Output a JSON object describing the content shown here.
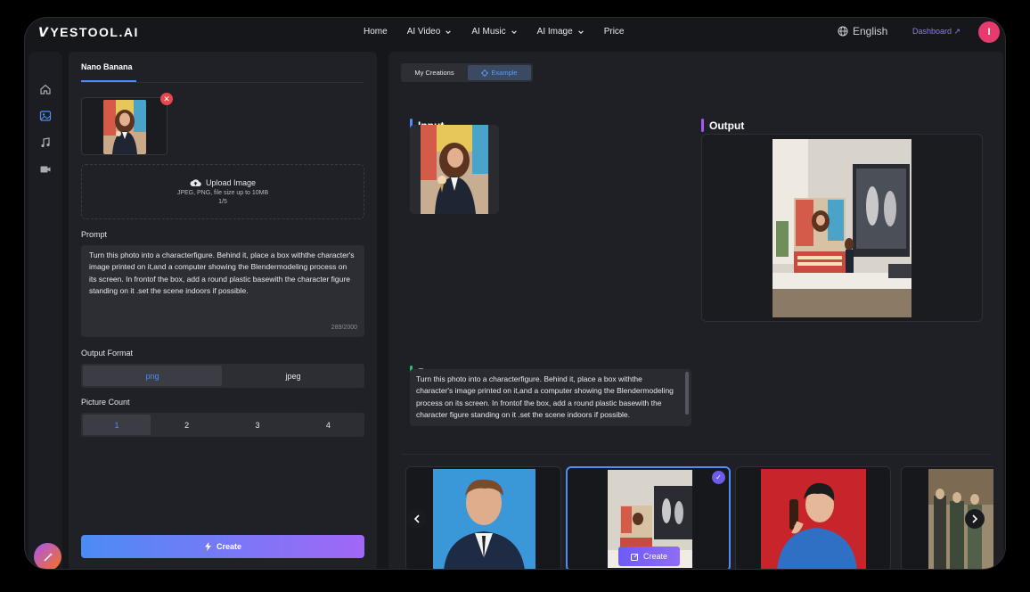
{
  "topnav": {
    "logo": "YESTOOL.AI",
    "menu": [
      {
        "label": "Home"
      },
      {
        "label": "AI Video"
      },
      {
        "label": "AI Music"
      },
      {
        "label": "AI Image"
      },
      {
        "label": "Price"
      }
    ],
    "language": "English",
    "dashboard": "Dashboard ↗",
    "avatar_initial": "I"
  },
  "sidebar": {
    "icons": [
      "home-icon",
      "image-icon",
      "music-icon",
      "video-icon"
    ]
  },
  "left": {
    "tab": "Nano Banana",
    "upload": {
      "title": "Upload Image",
      "hint": "JPEG, PNG, file size up to 10MB",
      "count": "1/5"
    },
    "prompt_label": "Prompt",
    "prompt_text": "Turn this photo into a characterfigure. Behind it, place a box withthe character's image printed on it,and a computer showing the Blendermodeling process on its screen. In frontof the box, add a round plastic basewith the character figure standing on it .set the scene indoors if possible.",
    "prompt_counter": "289/2000",
    "format_label": "Output Format",
    "formats": [
      "png",
      "jpeg"
    ],
    "format_selected": "png",
    "count_label": "Picture Count",
    "counts": [
      "1",
      "2",
      "3",
      "4"
    ],
    "count_selected": "1",
    "create_label": "Create"
  },
  "right": {
    "toggle": [
      "My Creations",
      "Example"
    ],
    "toggle_selected": "Example",
    "input_label": "Input",
    "output_label": "Output",
    "prompt_label": "Prompt",
    "prompt_text": "Turn this photo into a characterfigure. Behind it, place a box withthe character's image printed on it,and a computer showing the Blendermodeling process on its screen. In frontof the box, add a round plastic basewith the character figure standing on it .set the scene indoors if possible.",
    "card_create_label": "Create"
  },
  "colors": {
    "accent": "#4f8cf7",
    "purple": "#8b5cf6",
    "input_bar": "#4f8cf7",
    "output_bar": "#a855f7",
    "prompt_bar": "#22c55e"
  }
}
